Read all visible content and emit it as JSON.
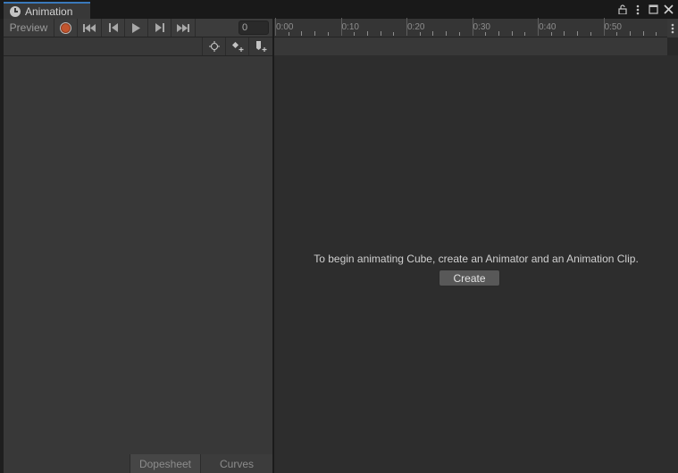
{
  "window": {
    "tab_label": "Animation",
    "controls": [
      "lock-icon",
      "kebab-menu-icon",
      "maximize-icon",
      "close-icon"
    ]
  },
  "toolbar": {
    "preview_label": "Preview",
    "frame_value": "0",
    "record_color": "#c2552e"
  },
  "timeline": {
    "labels": [
      "0:00",
      "0:10",
      "0:20",
      "0:30",
      "0:40",
      "0:50"
    ]
  },
  "bottom_tabs": {
    "dopesheet": "Dopesheet",
    "curves": "Curves"
  },
  "main": {
    "message": "To begin animating Cube, create an Animator and an Animation Clip.",
    "create_label": "Create"
  },
  "colors": {
    "tab_accent": "#3a79bb",
    "panel": "#383838",
    "content": "#2d2d2d"
  }
}
